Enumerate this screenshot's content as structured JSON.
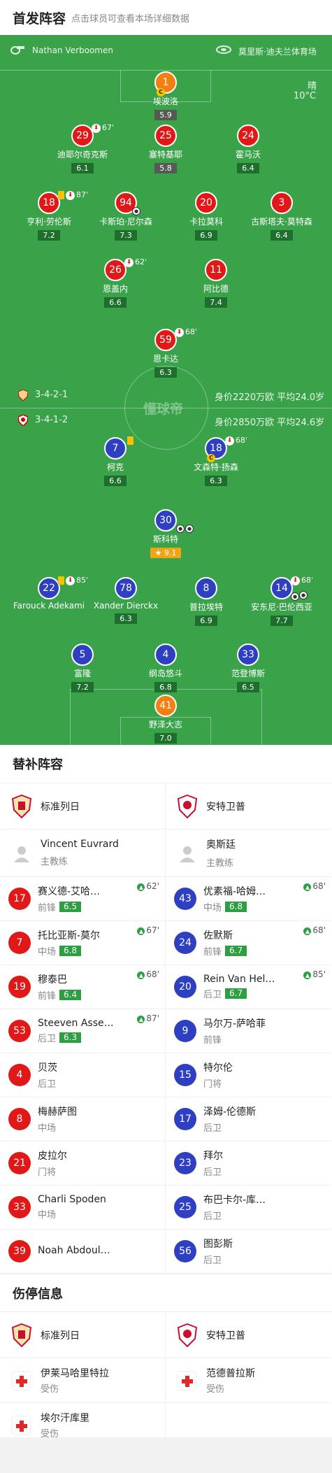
{
  "header": {
    "title": "首发阵容",
    "subtitle": "点击球员可查看本场详细数据"
  },
  "pitch": {
    "referee": "Nathan Verboomen",
    "stadium": "莫里斯·迪夫兰体育场",
    "weather": "晴",
    "temperature": "10°C",
    "watermark": "懂球帝",
    "home_formation": "3-4-2-1",
    "home_value": "身价2220万欧 平均24.0岁",
    "away_formation": "3-4-1-2",
    "away_value": "身价2850万欧 平均24.6岁"
  },
  "home_players": [
    {
      "num": "1",
      "name": "埃波洛",
      "rating": "5.9"
    },
    {
      "num": "29",
      "name": "迪耶尔奇克斯",
      "rating": "6.1",
      "sub_min": "67'"
    },
    {
      "num": "25",
      "name": "塞特基耶",
      "rating": "5.8"
    },
    {
      "num": "24",
      "name": "霍马沃",
      "rating": "6.4"
    },
    {
      "num": "18",
      "name": "亨利·劳伦斯",
      "rating": "7.2",
      "sub_min": "87'"
    },
    {
      "num": "94",
      "name": "卡斯珀·尼尔森",
      "rating": "7.3"
    },
    {
      "num": "20",
      "name": "卡拉莫科",
      "rating": "6.9"
    },
    {
      "num": "3",
      "name": "古斯塔夫·莫特森",
      "rating": "6.4"
    },
    {
      "num": "26",
      "name": "恩盖内",
      "rating": "6.6",
      "sub_min": "62'"
    },
    {
      "num": "11",
      "name": "阿比德",
      "rating": "7.4"
    },
    {
      "num": "59",
      "name": "恩卡达",
      "rating": "6.3",
      "sub_min": "68'"
    }
  ],
  "away_players": [
    {
      "num": "7",
      "name": "柯克",
      "rating": "6.6"
    },
    {
      "num": "18",
      "name": "文森特·扬森",
      "rating": "6.3",
      "sub_min": "68'"
    },
    {
      "num": "30",
      "name": "斯科特",
      "rating": "9.1"
    },
    {
      "num": "22",
      "name": "Farouck Adekami",
      "rating": "",
      "sub_min": "85'"
    },
    {
      "num": "78",
      "name": "Xander Dierckx",
      "rating": "6.3"
    },
    {
      "num": "8",
      "name": "普拉埃特",
      "rating": "6.9"
    },
    {
      "num": "14",
      "name": "安东尼·巴伦西亚",
      "rating": "7.7",
      "sub_min": "68'"
    },
    {
      "num": "5",
      "name": "富隆",
      "rating": "7.2"
    },
    {
      "num": "4",
      "name": "纲岛悠斗",
      "rating": "6.8"
    },
    {
      "num": "33",
      "name": "范登博斯",
      "rating": "6.5"
    },
    {
      "num": "41",
      "name": "野泽大志",
      "rating": "7.0"
    }
  ],
  "subs": {
    "title": "替补阵容",
    "home_team": "标准列日",
    "away_team": "安特卫普",
    "home_coach": {
      "name": "Vincent Euvrard",
      "role": "主教练"
    },
    "away_coach": {
      "name": "奥斯廷",
      "role": "主教练"
    },
    "home": [
      {
        "num": "17",
        "name": "赛义德-艾哈…",
        "pos": "前锋",
        "rating": "6.5",
        "min": "62'"
      },
      {
        "num": "7",
        "name": "托比亚斯-莫尔",
        "pos": "中场",
        "rating": "6.8",
        "min": "67'"
      },
      {
        "num": "19",
        "name": "穆泰巴",
        "pos": "前锋",
        "rating": "6.4",
        "min": "68'"
      },
      {
        "num": "53",
        "name": "Steeven Asse…",
        "pos": "后卫",
        "rating": "6.3",
        "min": "87'"
      },
      {
        "num": "4",
        "name": "贝茨",
        "pos": "后卫",
        "rating": "",
        "min": ""
      },
      {
        "num": "8",
        "name": "梅赫萨图",
        "pos": "中场",
        "rating": "",
        "min": ""
      },
      {
        "num": "21",
        "name": "皮拉尔",
        "pos": "门将",
        "rating": "",
        "min": ""
      },
      {
        "num": "33",
        "name": "Charli Spoden",
        "pos": "中场",
        "rating": "",
        "min": ""
      },
      {
        "num": "39",
        "name": "Noah Abdoula…",
        "pos": "",
        "rating": "",
        "min": ""
      }
    ],
    "away": [
      {
        "num": "43",
        "name": "优素福-哈姆…",
        "pos": "中场",
        "rating": "6.8",
        "min": "68'"
      },
      {
        "num": "24",
        "name": "佐默斯",
        "pos": "前锋",
        "rating": "6.7",
        "min": "68'"
      },
      {
        "num": "20",
        "name": "Rein Van Hel…",
        "pos": "后卫",
        "rating": "6.7",
        "min": "85'"
      },
      {
        "num": "9",
        "name": "马尔万-萨哈菲",
        "pos": "前锋",
        "rating": "",
        "min": ""
      },
      {
        "num": "15",
        "name": "特尔伦",
        "pos": "门将",
        "rating": "",
        "min": ""
      },
      {
        "num": "17",
        "name": "泽姆-伦德斯",
        "pos": "后卫",
        "rating": "",
        "min": ""
      },
      {
        "num": "23",
        "name": "拜尔",
        "pos": "后卫",
        "rating": "",
        "min": ""
      },
      {
        "num": "25",
        "name": "布巴卡尔-库…",
        "pos": "后卫",
        "rating": "",
        "min": ""
      },
      {
        "num": "56",
        "name": "图彭斯",
        "pos": "后卫",
        "rating": "",
        "min": ""
      }
    ]
  },
  "injuries": {
    "title": "伤停信息",
    "home_team": "标准列日",
    "away_team": "安特卫普",
    "home": [
      {
        "name": "伊莱马哈里特拉",
        "status": "受伤"
      },
      {
        "name": "埃尔汗库里",
        "status": "受伤"
      }
    ],
    "away": [
      {
        "name": "范德普拉斯",
        "status": "受伤"
      }
    ]
  },
  "colors": {
    "pitch": "#3aa34a",
    "home": "#e01818",
    "away": "#2f3fc2",
    "keeper": "#f47f10",
    "rating": "#1e6e2d",
    "accent": "#2e9e43"
  }
}
